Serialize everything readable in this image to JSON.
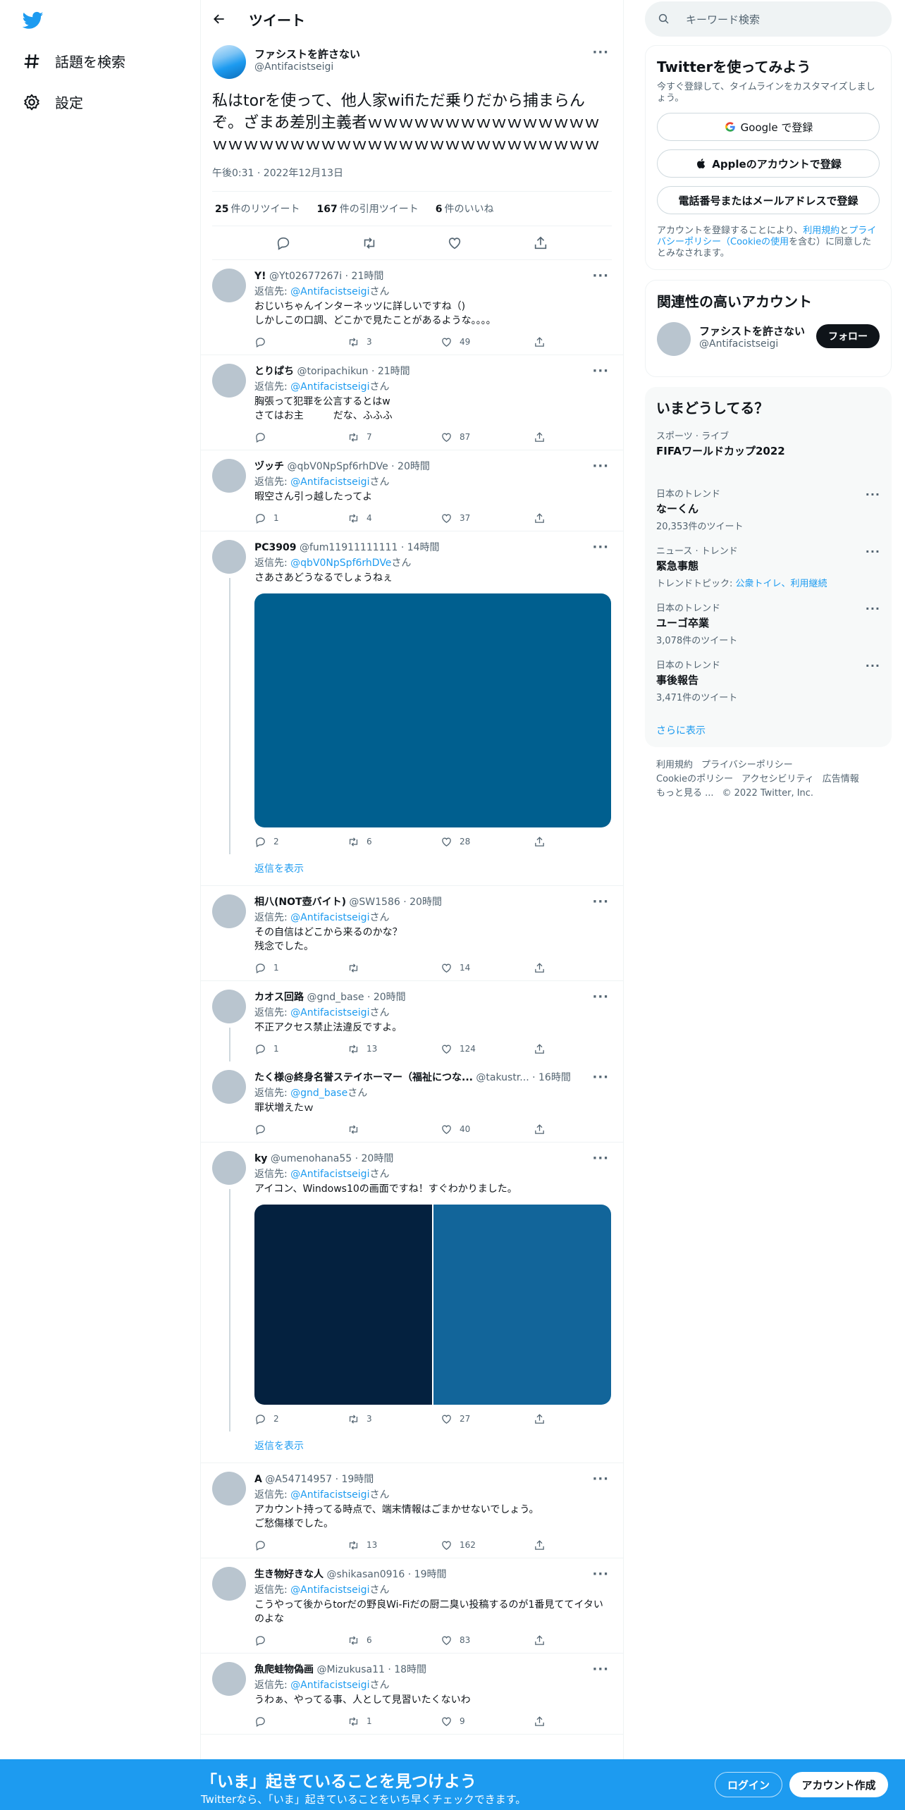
{
  "nav": {
    "explore": "話題を検索",
    "settings": "設定"
  },
  "header": {
    "title": "ツイート"
  },
  "main": {
    "name": "ファシストを許さない",
    "handle": "@Antifacistseigi",
    "text": "私はtorを使って、他人家wifiただ乗りだから捕まらんぞ。ざまあ差別主義者ｗｗｗｗｗｗｗｗｗｗｗｗｗｗｗｗｗｗｗｗｗｗｗｗｗｗｗｗｗｗｗｗｗｗｗｗｗｗｗｗ",
    "time": "午後0:31 · 2022年12月13日",
    "retweets": "25",
    "retweets_label": "件のリツイート",
    "quotes": "167",
    "quotes_label": "件の引用ツイート",
    "likes": "6",
    "likes_label": "件のいいね"
  },
  "replies": [
    {
      "name": "Y!",
      "handle": "@Yt02677267i",
      "time": "· 21時間",
      "to_label": "返信先: ",
      "to": "@Antifacistseigi",
      "san": "さん",
      "text": "おじいちゃんインターネッツに詳しいですね（)\nしかしこの口調、どこかで見たことがあるような。。。。",
      "replies": "",
      "rts": "3",
      "likes": "49"
    },
    {
      "name": "とりぱち",
      "handle": "@toripachikun",
      "time": "· 21時間",
      "to_label": "返信先: ",
      "to": "@Antifacistseigi",
      "san": "さん",
      "text": "胸張って犯罪を公言するとはw\nさてはお主　　　だな、ふふふ",
      "replies": "",
      "rts": "7",
      "likes": "87"
    },
    {
      "name": "ヅッチ",
      "handle": "@qbV0NpSpf6rhDVe",
      "time": "· 20時間",
      "to_label": "返信先: ",
      "to": "@Antifacistseigi",
      "san": "さん",
      "text": "暇空さん引っ越したってよ",
      "replies": "1",
      "rts": "4",
      "likes": "37"
    },
    {
      "name": "PC3909",
      "handle": "@fum11911111111",
      "time": "· 14時間",
      "to_label": "返信先: ",
      "to": "@qbV0NpSpf6rhDVe",
      "san": "さん",
      "text": "さあさあどうなるでしょうねぇ",
      "replies": "2",
      "rts": "6",
      "likes": "28"
    },
    {
      "name": "相八(NOT壺バイト)",
      "handle": "@SW1586",
      "time": "· 20時間",
      "to_label": "返信先: ",
      "to": "@Antifacistseigi",
      "san": "さん",
      "text": "その自信はどこから来るのかな？\n残念でした。",
      "replies": "1",
      "rts": "",
      "likes": "14"
    },
    {
      "name": "カオス回路",
      "handle": "@gnd_base",
      "time": "· 20時間",
      "to_label": "返信先: ",
      "to": "@Antifacistseigi",
      "san": "さん",
      "text": "不正アクセス禁止法違反ですよ。",
      "replies": "1",
      "rts": "13",
      "likes": "124"
    },
    {
      "name": "たく様@終身名誉ステイホーマー（福祉につな...",
      "handle": "@takustr...",
      "time": "· 16時間",
      "to_label": "返信先: ",
      "to": "@gnd_base",
      "san": "さん",
      "text": "罪状増えたｗ",
      "replies": "",
      "rts": "",
      "likes": "40"
    },
    {
      "name": "ky",
      "handle": "@umenohana55",
      "time": "· 20時間",
      "to_label": "返信先: ",
      "to": "@Antifacistseigi",
      "san": "さん",
      "text": "アイコン、Windows10の画面ですね！すぐわかりました。",
      "replies": "2",
      "rts": "3",
      "likes": "27"
    },
    {
      "name": "A",
      "handle": "@A54714957",
      "time": "· 19時間",
      "to_label": "返信先: ",
      "to": "@Antifacistseigi",
      "san": "さん",
      "text": "アカウント持ってる時点で、端末情報はごまかせないでしょう。\nご愁傷様でした。",
      "replies": "",
      "rts": "13",
      "likes": "162"
    },
    {
      "name": "生き物好きな人",
      "handle": "@shikasan0916",
      "time": "· 19時間",
      "to_label": "返信先: ",
      "to": "@Antifacistseigi",
      "san": "さん",
      "text": "こうやって後からtorだの野良Wi-Fiだの厨二臭い投稿するのが1番見ててイタいのよな",
      "replies": "",
      "rts": "6",
      "likes": "83"
    },
    {
      "name": "魚爬蛙物偽画",
      "handle": "@Mizukusa11",
      "time": "· 18時間",
      "to_label": "返信先: ",
      "to": "@Antifacistseigi",
      "san": "さん",
      "text": "うわぁ、やってる事、人として見習いたくないわ",
      "replies": "",
      "rts": "1",
      "likes": "9"
    }
  ],
  "show_replies": "返信を表示",
  "sidebar": {
    "search_placeholder": "キーワード検索",
    "signup": {
      "title": "Twitterを使ってみよう",
      "sub": "今すぐ登録して、タイムラインをカスタマイズしましょう。",
      "google": "Google で登録",
      "apple": "Appleのアカウントで登録",
      "phone": "電話番号またはメールアドレスで登録",
      "terms_a": "アカウントを登録することにより、",
      "terms_link1": "利用規約",
      "terms_b": "と",
      "terms_link2": "プライバシーポリシー（Cookieの使用",
      "terms_c": "を含む）に同意したとみなされます。"
    },
    "relevant": {
      "title": "関連性の高いアカウント",
      "name": "ファシストを許さない",
      "handle": "@Antifacistseigi",
      "follow": "フォロー"
    },
    "trends": {
      "title": "いまどうしてる？",
      "items": [
        {
          "cat": "スポーツ · ライブ",
          "name": "FIFAワールドカップ2022",
          "count": ""
        },
        {
          "cat": "日本のトレンド",
          "name": "なーくん",
          "count": "20,353件のツイート"
        },
        {
          "cat": "ニュース · トレンド",
          "name": "緊急事態",
          "count": "トレンドトピック: ",
          "links": "公衆トイレ、利用継続"
        },
        {
          "cat": "日本のトレンド",
          "name": "ユーゴ卒業",
          "count": "3,078件のツイート"
        },
        {
          "cat": "日本のトレンド",
          "name": "事後報告",
          "count": "3,471件のツイート"
        }
      ],
      "more": "さらに表示"
    },
    "footer": {
      "l1": "利用規約",
      "l2": "プライバシーポリシー",
      "l3": "Cookieのポリシー",
      "l4": "アクセシビリティ",
      "l5": "広告情報",
      "l6": "もっと見る ...",
      "l7": "© 2022 Twitter, Inc."
    }
  },
  "banner": {
    "title": "「いま」起きていることを見つけよう",
    "sub": "Twitterなら、「いま」起きていることをいち早くチェックできます。",
    "login": "ログイン",
    "signup": "アカウント作成"
  },
  "colors": {
    "accent": "#1d9bf0",
    "media1": "#005f8f",
    "media2a": "#04213f",
    "media2b": "#12659a"
  }
}
